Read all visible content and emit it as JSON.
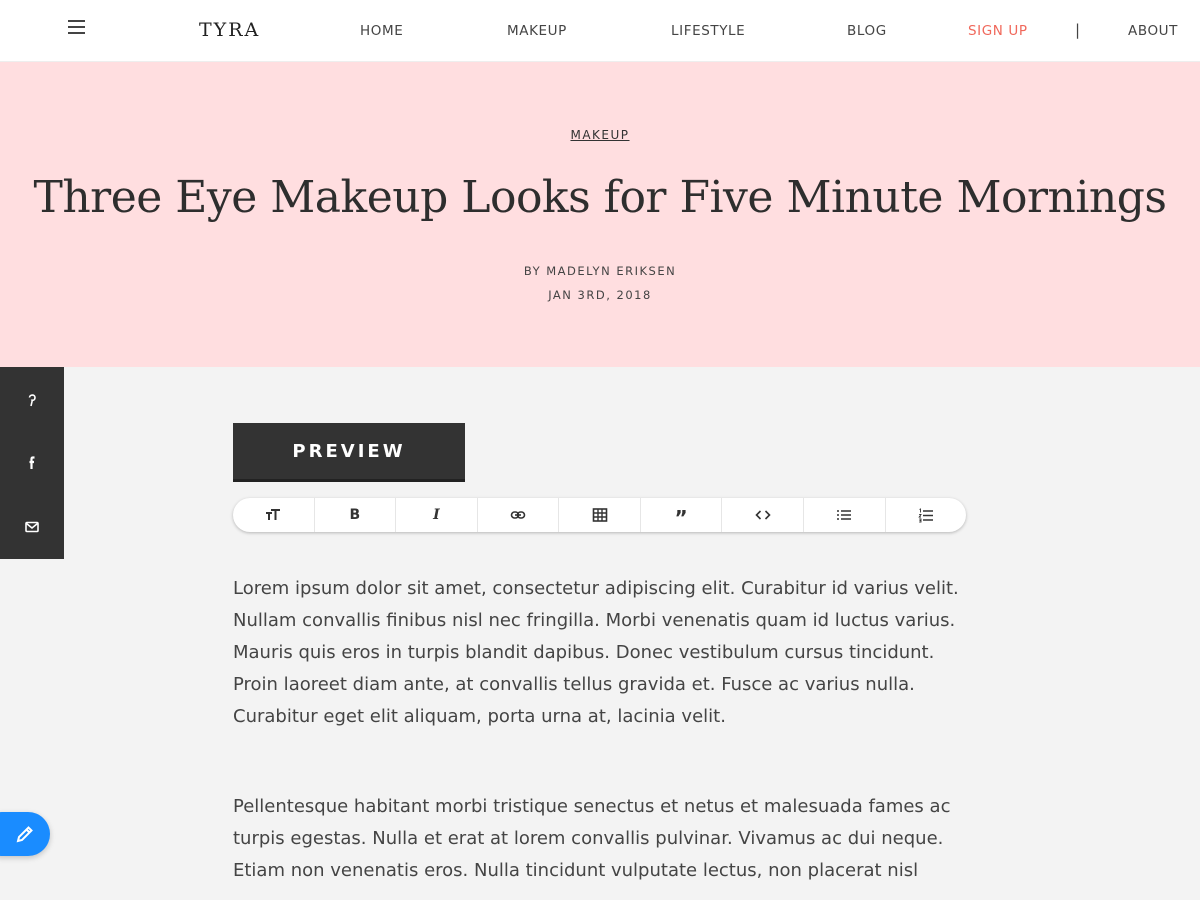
{
  "header": {
    "logo": "TYRA",
    "nav": {
      "home": "HOME",
      "makeup": "MAKEUP",
      "lifestyle": "LIFESTYLE",
      "blog": "BLOG",
      "signup": "SIGN UP",
      "separator": "|",
      "about": "ABOUT"
    },
    "signup_color": "#f0685b"
  },
  "hero": {
    "category": "MAKEUP",
    "title": "Three Eye Makeup Looks for Five Minute Mornings",
    "byline": "BY MADELYN ERIKSEN",
    "date": "JAN 3RD, 2018",
    "background": "#ffdee0"
  },
  "social": [
    "pinterest-icon",
    "facebook-icon",
    "email-icon"
  ],
  "editor": {
    "preview_label": "PREVIEW",
    "toolbar": [
      "text-size-icon",
      "bold-icon",
      "italic-icon",
      "link-icon",
      "table-icon",
      "quote-icon",
      "code-icon",
      "bullet-list-icon",
      "numbered-list-icon"
    ],
    "bold_glyph": "B",
    "italic_glyph": "I",
    "quote_glyph": "”"
  },
  "content": {
    "paragraphs": [
      "Lorem ipsum dolor sit amet, consectetur adipiscing elit. Curabitur id varius velit. Nullam convallis finibus nisl nec fringilla. Morbi venenatis quam id luctus varius. Mauris quis eros in turpis blandit dapibus. Donec vestibulum cursus tincidunt. Proin laoreet diam ante, at convallis tellus gravida et. Fusce ac varius nulla. Curabitur eget elit aliquam, porta urna at, lacinia velit.",
      "Pellentesque habitant morbi tristique senectus et netus et malesuada fames ac turpis egestas. Nulla et erat at lorem convallis pulvinar. Vivamus ac dui neque. Etiam non venenatis eros. Nulla tincidunt vulputate lectus, non placerat nisl"
    ]
  },
  "fab_color": "#1a8cff"
}
